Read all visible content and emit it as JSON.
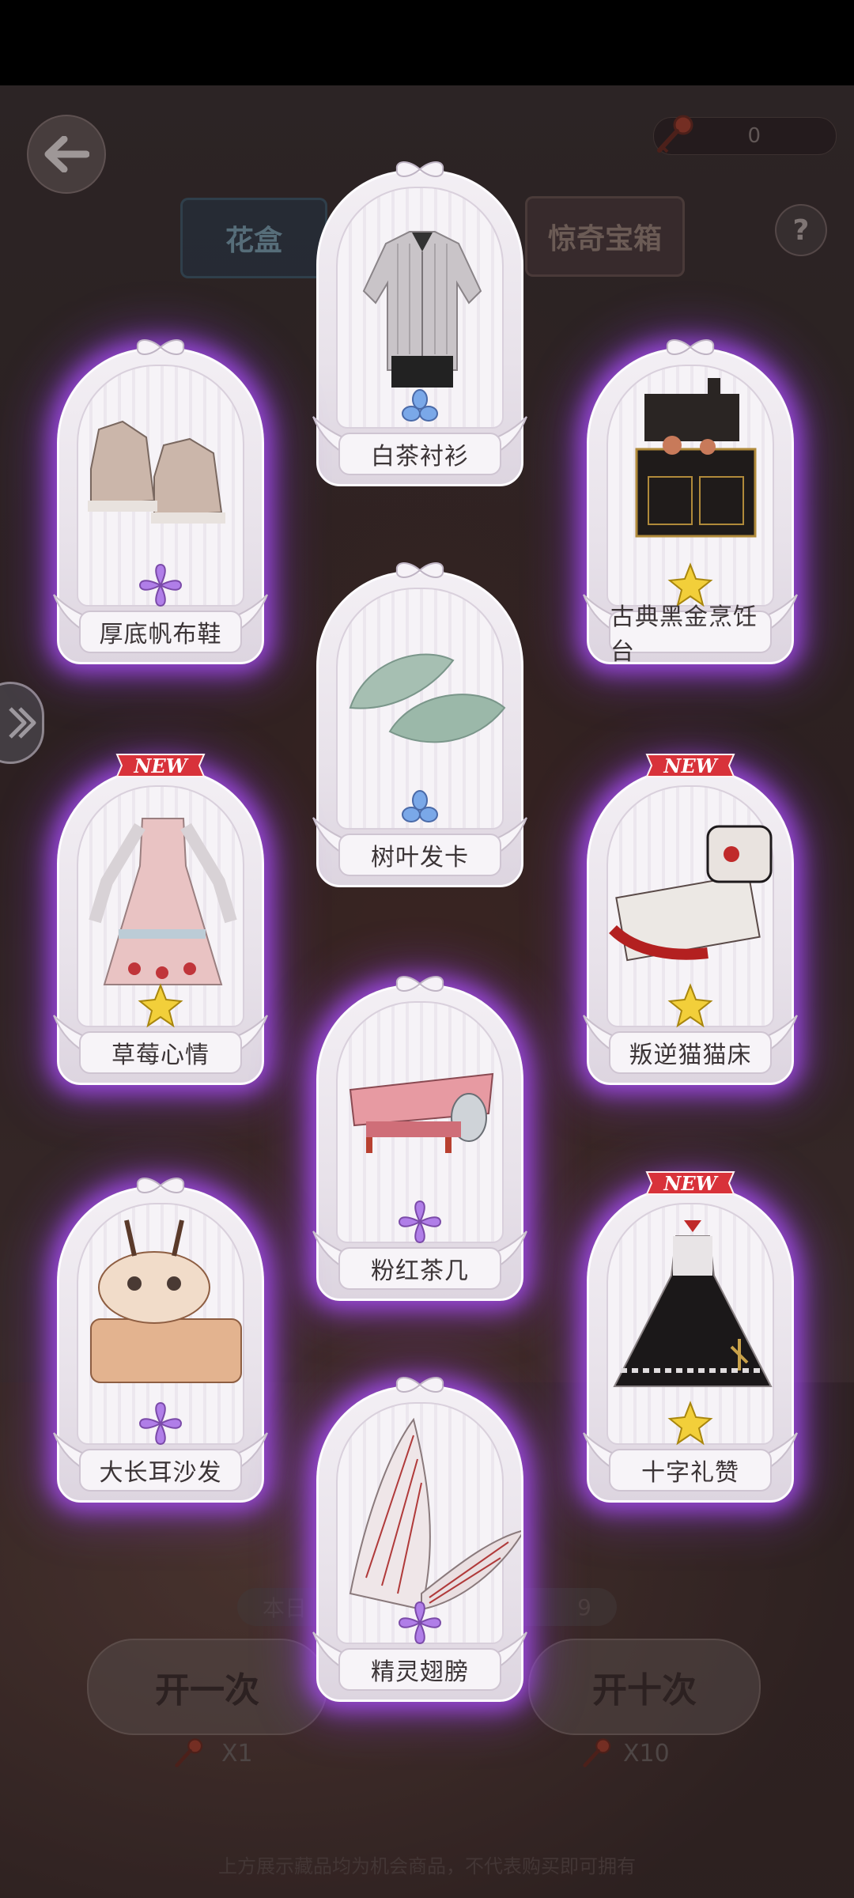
{
  "header": {
    "key_count": "0",
    "tab_flower": "花盒",
    "tab_surprise": "惊奇宝箱",
    "help_label": "?"
  },
  "cards": [
    {
      "name": "白茶衬衫",
      "rarity": "blue",
      "new": false
    },
    {
      "name": "厚底帆布鞋",
      "rarity": "purple",
      "new": false
    },
    {
      "name": "古典黑金烹饪台",
      "rarity": "gold",
      "new": false
    },
    {
      "name": "树叶发卡",
      "rarity": "blue",
      "new": false
    },
    {
      "name": "草莓心情",
      "rarity": "gold",
      "new": true
    },
    {
      "name": "叛逆猫猫床",
      "rarity": "gold",
      "new": true
    },
    {
      "name": "粉红茶几",
      "rarity": "purple",
      "new": false
    },
    {
      "name": "大长耳沙发",
      "rarity": "purple",
      "new": false
    },
    {
      "name": "十字礼赞",
      "rarity": "gold",
      "new": true
    },
    {
      "name": "精灵翅膀",
      "rarity": "purple",
      "new": false
    }
  ],
  "new_label": "NEW",
  "footer": {
    "daily_left": "本日",
    "daily_right": "9",
    "open_once": "开一次",
    "open_ten": "开十次",
    "cost_once": "X1",
    "cost_ten": "X10",
    "disclaimer": "上方展示藏品均为机会商品，不代表购买即可拥有"
  },
  "colors": {
    "glow": "#b050ff",
    "rarity_blue": "#7aa8e8",
    "rarity_purple": "#b07ee8",
    "rarity_gold": "#f2cf3a"
  }
}
